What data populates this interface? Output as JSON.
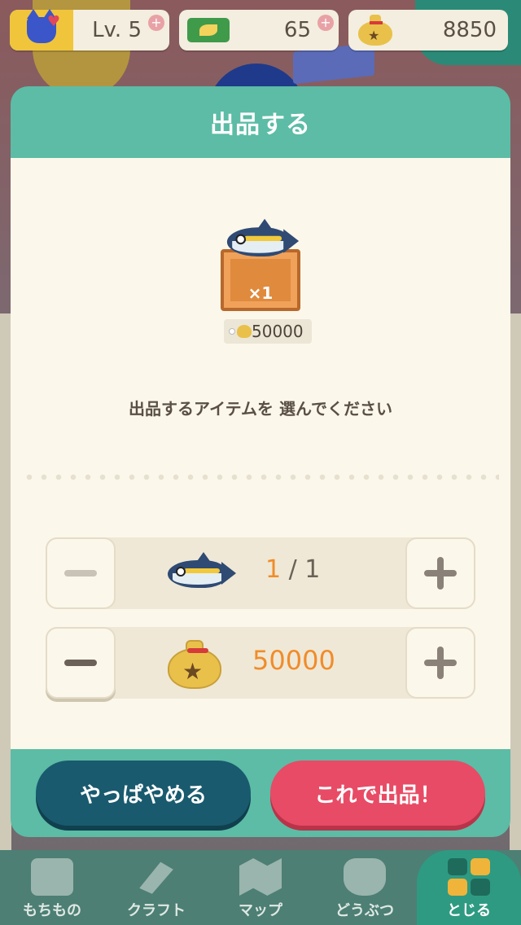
{
  "status": {
    "level": "Lv. 5",
    "tickets": "65",
    "bells": "8850"
  },
  "modal": {
    "title": "出品する",
    "item": {
      "quantity_badge": "×1",
      "price": "50000"
    },
    "instruction": "出品するアイテムを 選んでください",
    "quantity_stepper": {
      "current": "1",
      "separator": "/",
      "max": "1"
    },
    "price_stepper": {
      "value": "50000"
    },
    "cancel_label": "やっぱやめる",
    "confirm_label": "これで出品！"
  },
  "nav": {
    "items": [
      {
        "label": "もちもの"
      },
      {
        "label": "クラフト"
      },
      {
        "label": "マップ"
      },
      {
        "label": "どうぶつ"
      },
      {
        "label": "とじる"
      }
    ]
  },
  "colors": {
    "modal_header": "#5cbca6",
    "accent_orange": "#f08c2a",
    "cancel_button": "#195a6e",
    "confirm_button": "#e84b65"
  }
}
